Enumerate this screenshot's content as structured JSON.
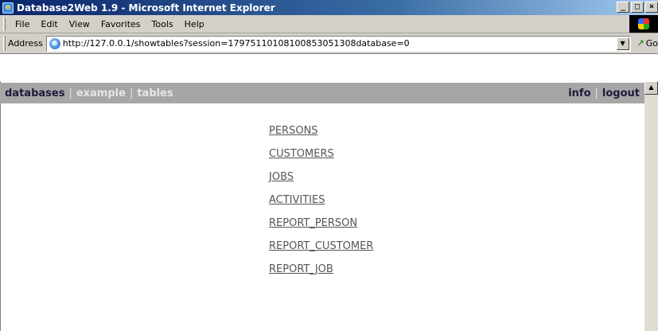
{
  "window": {
    "title": "Database2Web 1.9 - Microsoft Internet Explorer",
    "app_icon": "ie-page-icon",
    "controls": [
      "_",
      "□",
      "×"
    ]
  },
  "menu": [
    "File",
    "Edit",
    "View",
    "Favorites",
    "Tools",
    "Help"
  ],
  "address": {
    "label": "Address",
    "url": "http://127.0.0.1/showtables?session=17975110108100853051308database=0",
    "go_label": "Go"
  },
  "nav": {
    "left": [
      "databases",
      "example",
      "tables"
    ],
    "right": [
      "info",
      "logout"
    ],
    "colors": {
      "bar": "#a6a6a6",
      "active": "#1b1b3a",
      "dim": "#e6e6e6"
    }
  },
  "tables": [
    "PERSONS",
    "CUSTOMERS",
    "JOBS",
    "ACTIVITIES",
    "REPORT_PERSON",
    "REPORT_CUSTOMER",
    "REPORT_JOB"
  ]
}
